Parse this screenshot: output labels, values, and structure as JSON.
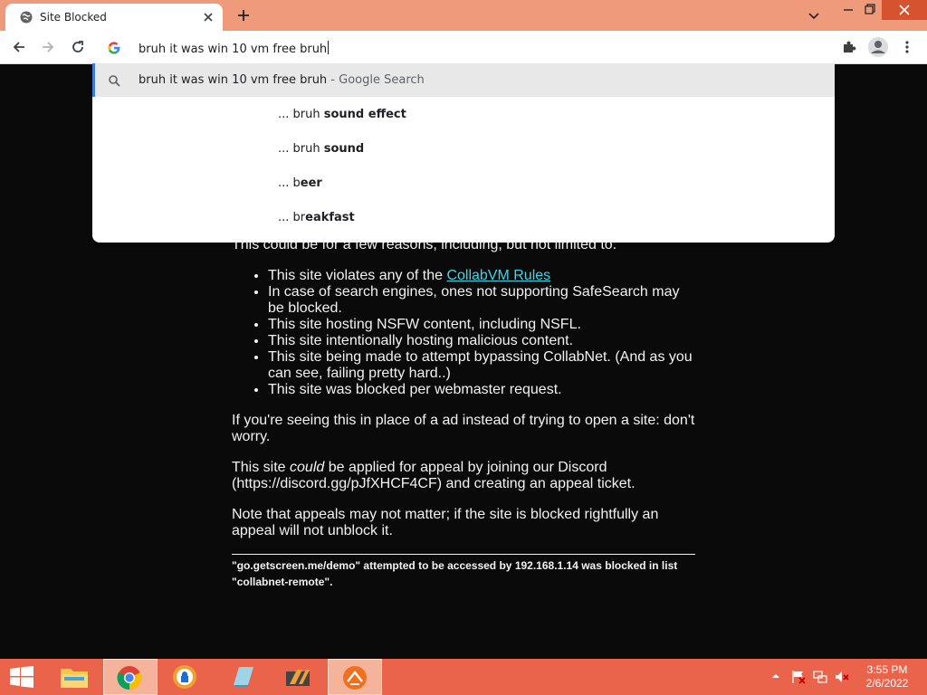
{
  "tab": {
    "title": "Site Blocked"
  },
  "omnibox": {
    "text": "bruh it was win 10 vm free bruh"
  },
  "dropdown": {
    "search_text": "bruh it was win 10 vm free bruh",
    "search_suffix": " - Google Search",
    "suggestions": [
      {
        "prefix": "... bruh ",
        "bold": "sound effect"
      },
      {
        "prefix": "... bruh ",
        "bold": "sound"
      },
      {
        "prefix": "... b",
        "bold": "eer"
      },
      {
        "prefix": "... br",
        "bold": "eakfast"
      }
    ]
  },
  "page": {
    "intro": "This could be for a few reasons, including, but not limited to:",
    "bullets": {
      "b1_prefix": "This site violates any of the ",
      "b1_link": "CollabVM Rules",
      "b2": "In case of search engines, ones not supporting SafeSearch may be blocked.",
      "b3": "This site hosting NSFW content, including NSFL.",
      "b4": "This site intentionally hosting malicious content.",
      "b5": "This site being made to attempt bypassing CollabNet. (And as you can see, failing pretty hard..)",
      "b6": "This site was blocked per webmaster request."
    },
    "para_ad": "If you're seeing this in place of a ad instead of trying to open a site: don't worry.",
    "appeal_1": "This site ",
    "appeal_em": "could",
    "appeal_2": " be applied for appeal by joining our Discord (https://discord.gg/pJfXHCF4CF) and creating an appeal ticket.",
    "note": "Note that appeals may not matter; if the site is blocked rightfully an appeal will not unblock it.",
    "footer": {
      "part1": "\"go.getscreen.me/demo\" attempted to be accessed by ",
      "ip": "192.168.1.14",
      "part2": " was blocked in list \"collabnet-remote\"."
    }
  },
  "taskbar": {
    "time": "3:55 PM",
    "date": "2/6/2022"
  },
  "colors": {
    "tabstrip": "#f09a7c",
    "taskbar": "#e9644a",
    "link": "#3cd6e6",
    "page_bg": "#0a0a0a"
  }
}
